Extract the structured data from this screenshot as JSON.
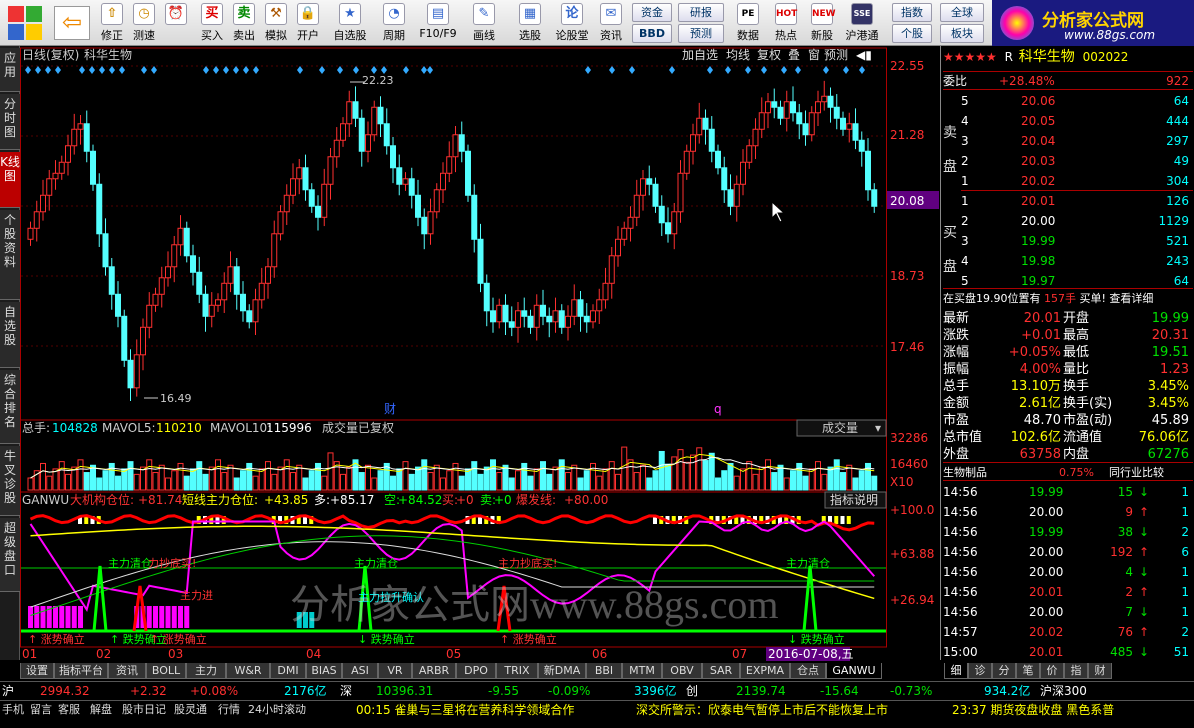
{
  "toolbar": {
    "buttons": [
      "修正",
      "测速",
      "买入",
      "卖出",
      "模拟",
      "开户",
      "自选股",
      "周期",
      "F10/F9",
      "画线",
      "选股",
      "论股堂",
      "资讯",
      "数据",
      "热点",
      "新股",
      "沪港通"
    ],
    "box_buttons": [
      "资金",
      "研报",
      "BBD",
      "预测",
      "指数",
      "全球",
      "个股",
      "板块"
    ],
    "logo_title": "分析家公式网",
    "logo_url": "www.88gs.com"
  },
  "sidebar": [
    "应用",
    "分时图",
    "K线图",
    "个股资料",
    "自选股",
    "综合排名",
    "牛叉诊股",
    "超级盘口"
  ],
  "chart_header": {
    "label": "日线(复权)",
    "stock_name": "科华生物",
    "buttons": [
      "加自选",
      "均线",
      "复权",
      "叠",
      "窗",
      "预测"
    ]
  },
  "price_axis": [
    "22.55",
    "21.28",
    "20.08",
    "18.73",
    "17.46"
  ],
  "annotations": {
    "high": "22.23",
    "low": "16.49",
    "cai": "财",
    "q": "q"
  },
  "volume_header": {
    "zongshou_label": "总手:",
    "zongshou": "104828",
    "mavol5_label": "MAVOL5:",
    "mavol5": "110210",
    "mavol10_label": "MAVOL10:",
    "mavol10": "115996",
    "note": "成交量已复权",
    "dropdown": "成交量"
  },
  "volume_axis": [
    "32286",
    "16460",
    "X10"
  ],
  "indicator_header": {
    "name": "GANWU",
    "text1": "大机构仓位:",
    "v1": "+81.74",
    "text2": "短线主力仓位:",
    "v2": "+43.85",
    "text3": "多:",
    "v3": "+85.17",
    "text4": "空:",
    "v4": "+84.52",
    "text5": "买:",
    "v5": "+0",
    "text6": "卖:",
    "v6": "+0",
    "text7": "爆发线:",
    "v7": "+80.00",
    "button": "指标说明"
  },
  "indicator_axis": [
    "+100.0",
    "+63.88",
    "+26.94"
  ],
  "indicator_labels": [
    "主力清仓",
    "力抄底买!",
    "主力清仓",
    "主力抄底买!",
    "主力清仓",
    "主力进",
    "主力拉升确认",
    "↑ 涨势确立",
    "↑ 跌势确立",
    "↓ 跌势确立",
    "↑ 涨势确立",
    "↑ 涨势确立",
    "↓ 跌势确立",
    "↑ 涨势确立",
    "↓ 跌势确立"
  ],
  "watermark": "分析家公式网www.88gs.com",
  "x_axis": {
    "months": [
      "01",
      "02",
      "03",
      "04",
      "05",
      "06",
      "07"
    ],
    "date_tag": "2016-07-08,五"
  },
  "bottom_tabs": [
    "设置",
    "指标平台",
    "资讯",
    "BOLL",
    "主力",
    "W&R",
    "DMI",
    "BIAS",
    "ASI",
    "VR",
    "ARBR",
    "DPO",
    "TRIX",
    "新DMA",
    "BBI",
    "MTM",
    "OBV",
    "SAR",
    "EXPMA",
    "仓点",
    "GANWU"
  ],
  "right_tabs": [
    "细",
    "诊",
    "分",
    "笔",
    "价",
    "指",
    "财"
  ],
  "quote": {
    "stars": "★★★★★",
    "r_label": "R",
    "name": "科华生物",
    "code": "002022",
    "weibi_label": "委比",
    "weibi": "+28.48%",
    "weicha": "922",
    "sell_label": "卖盘",
    "buy_label": "买盘",
    "sells": [
      [
        "5",
        "20.06",
        "64"
      ],
      [
        "4",
        "20.05",
        "444"
      ],
      [
        "3",
        "20.04",
        "297"
      ],
      [
        "2",
        "20.03",
        "49"
      ],
      [
        "1",
        "20.02",
        "304"
      ]
    ],
    "buys": [
      [
        "1",
        "20.01",
        "126"
      ],
      [
        "2",
        "20.00",
        "1129"
      ],
      [
        "3",
        "19.99",
        "521"
      ],
      [
        "4",
        "19.98",
        "243"
      ],
      [
        "5",
        "19.97",
        "64"
      ]
    ],
    "buyline": "在买盘19.90位置有",
    "buyline_vol": "157手",
    "buyline_act": "买单!",
    "buyline_link": "查看详细",
    "stats": [
      [
        "最新",
        "20.01",
        "开盘",
        "19.99"
      ],
      [
        "涨跌",
        "+0.01",
        "最高",
        "20.31"
      ],
      [
        "涨幅",
        "+0.05%",
        "最低",
        "19.51"
      ],
      [
        "振幅",
        "4.00%",
        "量比",
        "1.23"
      ],
      [
        "总手",
        "13.10万",
        "换手",
        "3.45%"
      ],
      [
        "金额",
        "2.61亿",
        "换手(实)",
        "3.45%"
      ],
      [
        "市盈",
        "48.70",
        "市盈(动)",
        "45.89"
      ],
      [
        "总市值",
        "102.6亿",
        "流通值",
        "76.06亿"
      ],
      [
        "外盘",
        "63758",
        "内盘",
        "67276"
      ]
    ],
    "industry": "生物制品",
    "industry_pct": "0.75%",
    "industry_btn": "同行业比较",
    "ticks": [
      [
        "14:56",
        "19.99",
        "15",
        "1"
      ],
      [
        "14:56",
        "20.00",
        "9",
        "1"
      ],
      [
        "14:56",
        "19.99",
        "38",
        "2"
      ],
      [
        "14:56",
        "20.00",
        "192",
        "6"
      ],
      [
        "14:56",
        "20.00",
        "4",
        "1"
      ],
      [
        "14:56",
        "20.01",
        "2",
        "1"
      ],
      [
        "14:56",
        "20.00",
        "7",
        "1"
      ],
      [
        "14:57",
        "20.02",
        "76",
        "2"
      ],
      [
        "15:00",
        "20.01",
        "485",
        "51"
      ]
    ]
  },
  "status1": {
    "hu": "沪",
    "hu_idx": "2994.32",
    "hu_chg": "+2.32",
    "hu_pct": "+0.08%",
    "hu_amt": "2176亿",
    "shen": "深",
    "shen_idx": "10396.31",
    "shen_chg": "-9.55",
    "shen_pct": "-0.09%",
    "shen_amt": "3396亿",
    "chuang": "创",
    "ch_idx": "2139.74",
    "ch_chg": "-15.64",
    "ch_pct": "-0.73%",
    "ch_amt": "934.2亿",
    "hs300": "沪深300"
  },
  "status2": {
    "items": [
      "手机",
      "留言",
      "客服",
      "解盘",
      "股市日记",
      "股灵通",
      "行情",
      "24小时滚动"
    ],
    "news1": "00:15 雀巢与三星将在营养科学领域合作",
    "news2": "深交所警示：欣泰电气暂停上市后不能恢复上市",
    "news3": "23:37 期货夜盘收盘 黑色系普"
  }
}
